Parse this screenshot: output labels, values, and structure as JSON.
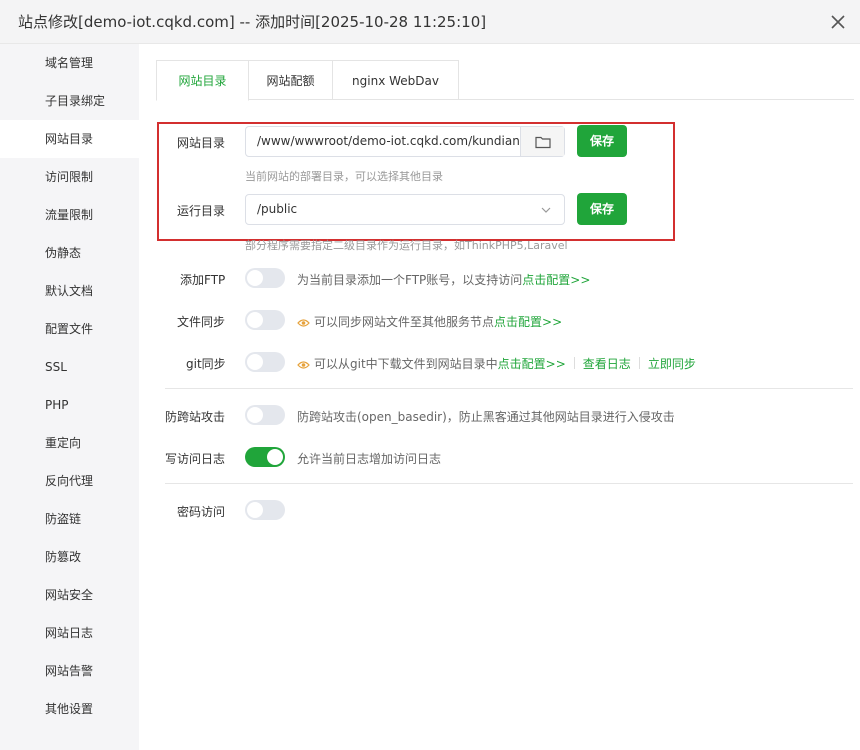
{
  "window": {
    "title": "站点修改[demo-iot.cqkd.com] -- 添加时间[2025-10-28 11:25:10]"
  },
  "sidebar": {
    "items": [
      {
        "label": "域名管理"
      },
      {
        "label": "子目录绑定"
      },
      {
        "label": "网站目录",
        "active": true
      },
      {
        "label": "访问限制"
      },
      {
        "label": "流量限制"
      },
      {
        "label": "伪静态"
      },
      {
        "label": "默认文档"
      },
      {
        "label": "配置文件"
      },
      {
        "label": "SSL"
      },
      {
        "label": "PHP"
      },
      {
        "label": "重定向"
      },
      {
        "label": "反向代理"
      },
      {
        "label": "防盗链"
      },
      {
        "label": "防篡改"
      },
      {
        "label": "网站安全"
      },
      {
        "label": "网站日志"
      },
      {
        "label": "网站告警"
      },
      {
        "label": "其他设置"
      }
    ]
  },
  "tabs": [
    {
      "label": "网站目录",
      "active": true
    },
    {
      "label": "网站配额"
    },
    {
      "label": "nginx WebDav"
    }
  ],
  "site_dir": {
    "label": "网站目录",
    "value": "/www/wwwroot/demo-iot.cqkd.com/kundiantong",
    "save": "保存",
    "hint": "当前网站的部署目录，可以选择其他目录"
  },
  "run_dir": {
    "label": "运行目录",
    "value": "/public",
    "save": "保存",
    "hint": "部分程序需要指定二级目录作为运行目录，如ThinkPHP5,Laravel"
  },
  "ftp": {
    "label": "添加FTP",
    "on": false,
    "desc": "为当前目录添加一个FTP账号，以支持访问",
    "link": "点击配置>>"
  },
  "file_sync": {
    "label": "文件同步",
    "on": false,
    "desc": "可以同步网站文件至其他服务节点",
    "link": "点击配置>>"
  },
  "git_sync": {
    "label": "git同步",
    "on": false,
    "desc": "可以从git中下载文件到网站目录中",
    "link": "点击配置>>",
    "link2": "查看日志",
    "link3": "立即同步"
  },
  "anti_xss": {
    "label": "防跨站攻击",
    "on": false,
    "desc": "防跨站攻击(open_basedir)，防止黑客通过其他网站目录进行入侵攻击"
  },
  "access_log": {
    "label": "写访问日志",
    "on": true,
    "desc": "允许当前日志增加访问日志"
  },
  "password": {
    "label": "密码访问",
    "on": false
  },
  "colors": {
    "accent": "#20a53a",
    "highlight_border": "#d32f2f"
  }
}
